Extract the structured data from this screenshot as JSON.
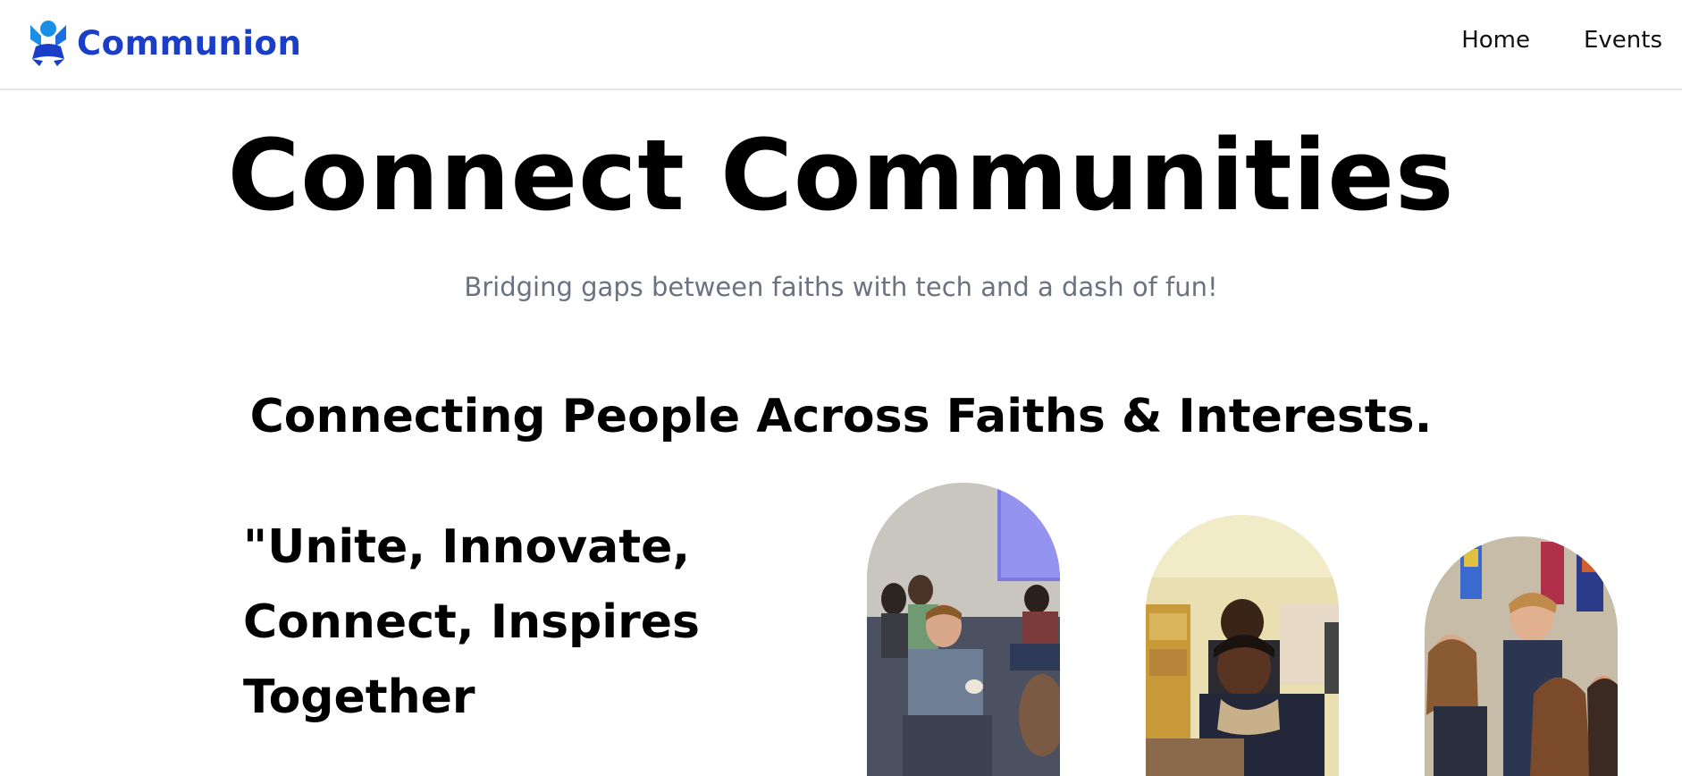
{
  "brand": {
    "name": "Communion",
    "logo_icon": "communion-logo-icon",
    "color": "#1a3ec8"
  },
  "nav": {
    "items": [
      {
        "label": "Home"
      },
      {
        "label": "Events"
      }
    ]
  },
  "hero": {
    "title": "Connect Communities",
    "subtitle": "Bridging gaps between faiths with tech and a dash of fun!"
  },
  "section": {
    "title": "Connecting People Across Faiths & Interests.",
    "quote": "\"Unite, Innovate, Connect, Inspires Together"
  },
  "gallery": {
    "images": [
      {
        "name": "group-discussion-photo"
      },
      {
        "name": "students-table-photo"
      },
      {
        "name": "worship-gathering-photo"
      }
    ]
  },
  "colors": {
    "subtitle": "#6b7280",
    "nav_border": "#e6e6e6"
  }
}
